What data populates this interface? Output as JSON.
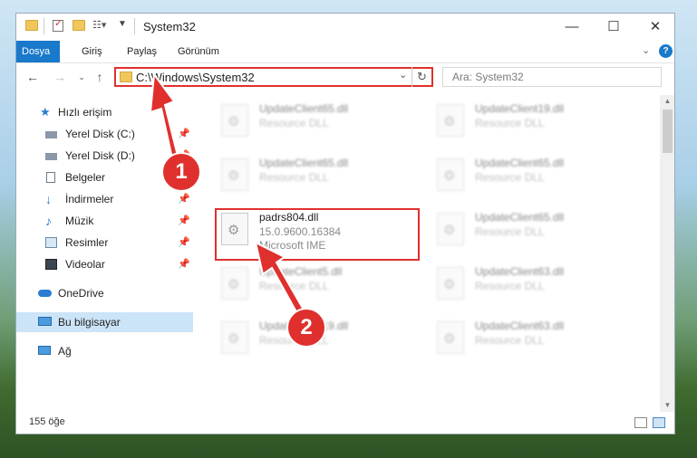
{
  "window": {
    "title": "System32",
    "controls": {
      "minimize": "—",
      "maximize": "☐",
      "close": "✕"
    }
  },
  "ribbon": {
    "tabs": [
      {
        "label": "Dosya",
        "active": true
      },
      {
        "label": "Giriş"
      },
      {
        "label": "Paylaş"
      },
      {
        "label": "Görünüm"
      }
    ]
  },
  "address": {
    "path": "C:\\Windows\\System32"
  },
  "search": {
    "placeholder": "Ara: System32"
  },
  "nav": {
    "items": [
      {
        "label": "Hızlı erişim",
        "icon": "star-icon"
      },
      {
        "label": "Yerel Disk (C:)",
        "icon": "drive-icon",
        "pinned": true
      },
      {
        "label": "Yerel Disk (D:)",
        "icon": "drive-icon",
        "pinned": true
      },
      {
        "label": "Belgeler",
        "icon": "documents-icon",
        "pinned": true
      },
      {
        "label": "İndirmeler",
        "icon": "download-icon",
        "pinned": true
      },
      {
        "label": "Müzik",
        "icon": "music-icon",
        "pinned": true
      },
      {
        "label": "Resimler",
        "icon": "pictures-icon",
        "pinned": true
      },
      {
        "label": "Videolar",
        "icon": "videos-icon",
        "pinned": true
      },
      {
        "label": "OneDrive",
        "icon": "onedrive-icon"
      },
      {
        "label": "Bu bilgisayar",
        "icon": "computer-icon",
        "selected": true
      },
      {
        "label": "Ağ",
        "icon": "network-icon"
      }
    ]
  },
  "files": [
    {
      "name": "UpdateClient65.dll",
      "line2": "Resource DLL",
      "line3": ""
    },
    {
      "name": "UpdateClient19.dll",
      "line2": "Resource DLL",
      "line3": ""
    },
    {
      "name": "UpdateClient65.dll",
      "line2": "Resource DLL",
      "line3": ""
    },
    {
      "name": "UpdateClient65.dll",
      "line2": "Resource DLL",
      "line3": ""
    },
    {
      "name": "padrs804.dll",
      "line2": "15.0.9600.16384",
      "line3": "Microsoft IME",
      "highlighted": true
    },
    {
      "name": "UpdateClient65.dll",
      "line2": "Resource DLL",
      "line3": ""
    },
    {
      "name": "UpdateClient5.dll",
      "line2": "Resource DLL",
      "line3": ""
    },
    {
      "name": "UpdateClient63.dll",
      "line2": "Resource DLL",
      "line3": ""
    },
    {
      "name": "UpdateClient19.dll",
      "line2": "Resource DLL",
      "line3": ""
    },
    {
      "name": "UpdateClient63.dll",
      "line2": "Resource DLL",
      "line3": ""
    }
  ],
  "status": {
    "count": "155 öğe"
  },
  "annotations": {
    "step1": "1",
    "step2": "2",
    "color": "#e0302e"
  },
  "colors": {
    "accent": "#1979ca",
    "highlight": "#e0302e",
    "selection": "#cce4f7"
  }
}
